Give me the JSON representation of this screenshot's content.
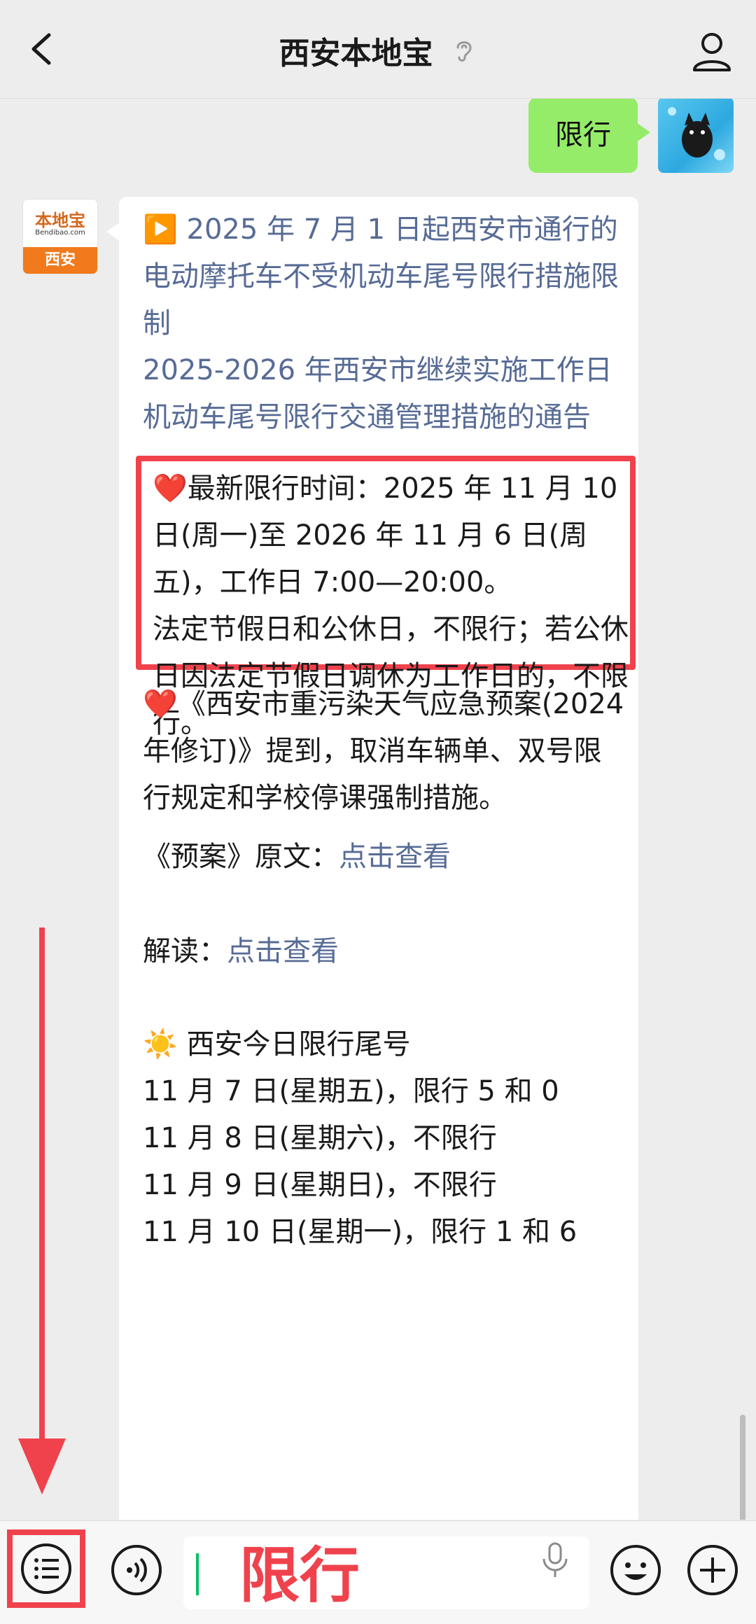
{
  "header": {
    "title": "西安本地宝"
  },
  "outgoing": {
    "text": "限行"
  },
  "bot_avatar": {
    "brand": "本地宝",
    "url": "Bendibao.com",
    "city": "西安"
  },
  "message": {
    "link1": "▶️ 2025 年 7 月 1 日起西安市通行的电动摩托车不受机动车尾号限行措施限制",
    "link2": " 2025-2026 年西安市继续实施工作日机动车尾号限行交通管理措施的通告",
    "highlight_heart": "❤️",
    "highlight_text": "最新限行时间：2025 年 11 月 10 日(周一)至 2026 年 11 月 6 日(周五)，工作日 7:00—20:00。",
    "highlight_text2": "法定节假日和公休日，不限行；若公休日因法定节假日调休为工作日的，不限行。",
    "plan_heart": "❤️",
    "plan_text": "《西安市重污染天气应急预案(2024 年修订)》提到，取消车辆单、双号限行规定和学校停课强制措施。",
    "original_label": "《预案》原文：",
    "original_link": "点击查看",
    "interpret_label": "解读：",
    "interpret_link": "点击查看",
    "today_icon": "☀️",
    "today_title": " 西安今日限行尾号",
    "days": [
      "11 月 7 日(星期五)，限行 5 和 0",
      "11 月 8 日(星期六)，不限行",
      "11 月 9 日(星期日)，不限行",
      "11 月 10 日(星期一)，限行 1 和 6"
    ]
  },
  "input": {
    "text": "限行"
  },
  "colors": {
    "accent_red": "#f0424c",
    "bubble_green": "#95ec69",
    "link_blue": "#576b95",
    "caret_green": "#07c160"
  }
}
